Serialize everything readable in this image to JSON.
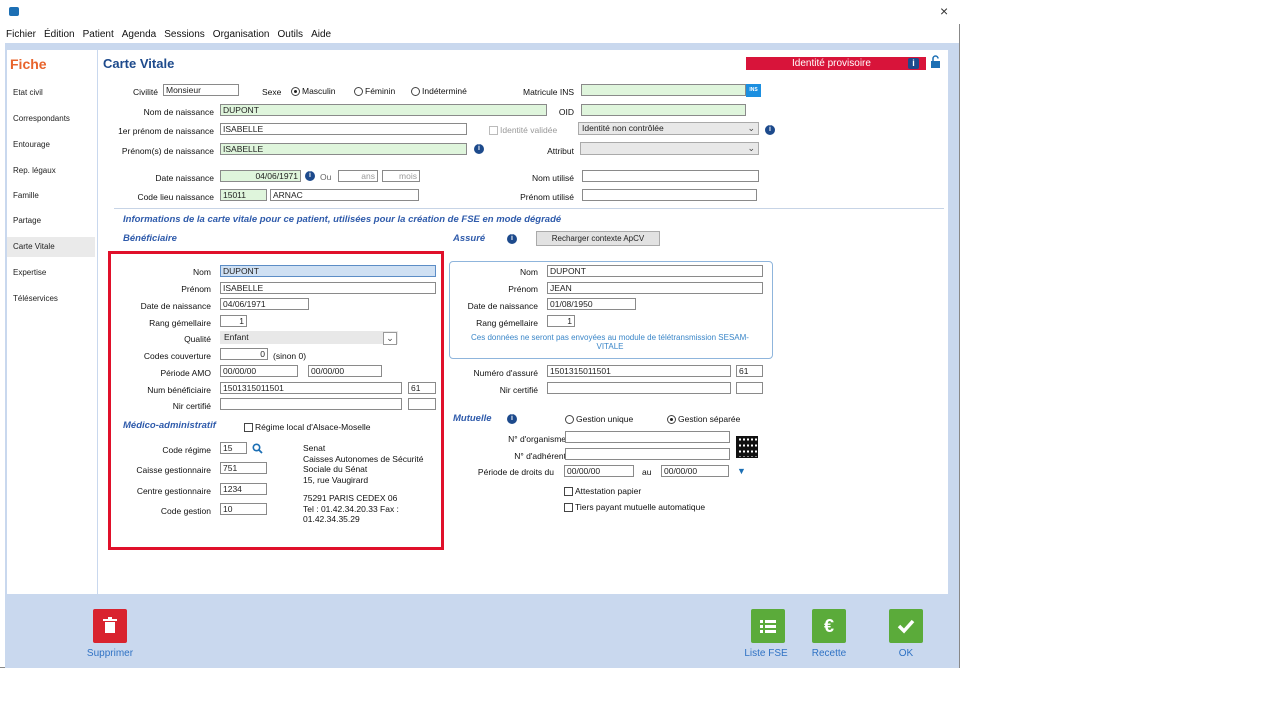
{
  "window": {
    "close": "×"
  },
  "menu": [
    "Fichier",
    "Édition",
    "Patient",
    "Agenda",
    "Sessions",
    "Organisation",
    "Outils",
    "Aide"
  ],
  "sidebar": {
    "title": "Fiche",
    "items": [
      "Etat civil",
      "Correspondants",
      "Entourage",
      "Rep. légaux",
      "Famille",
      "Partage",
      "Carte Vitale",
      "Expertise",
      "Téléservices"
    ],
    "active": "Carte Vitale"
  },
  "header": {
    "title": "Carte Vitale",
    "banner": "Identité provisoire",
    "banner_info": "i"
  },
  "identity": {
    "civilite_label": "Civilité",
    "civilite": "Monsieur",
    "sexe_label": "Sexe",
    "sexe_options": [
      "Masculin",
      "Féminin",
      "Indéterminé"
    ],
    "sexe_selected": "Masculin",
    "matricule_label": "Matricule INS",
    "matricule": "",
    "ins_badge": "INS",
    "nom_label": "Nom de naissance",
    "nom": "DUPONT",
    "oid_label": "OID",
    "oid": "",
    "prenom1_label": "1er prénom de naissance",
    "prenom1": "ISABELLE",
    "identite_validee_label": "Identité validée",
    "identite_status": "Identité non contrôlée",
    "prenoms_label": "Prénom(s) de naissance",
    "prenoms": "ISABELLE",
    "attribut_label": "Attribut",
    "attribut": "",
    "date_label": "Date naissance",
    "date": "04/06/1971",
    "ou_label": "Ou",
    "ans_placeholder": "ans",
    "mois_placeholder": "mois",
    "nom_utilise_label": "Nom utilisé",
    "nom_utilise": "",
    "code_lieu_label": "Code lieu naissance",
    "code_lieu": "15011",
    "lieu": "ARNAC",
    "prenom_utilise_label": "Prénom utilisé",
    "prenom_utilise": ""
  },
  "carte": {
    "info_text": "Informations de la carte vitale pour ce patient, utilisées pour la création de FSE en mode dégradé",
    "beneficiaire_title": "Bénéficiaire",
    "assure_title": "Assuré",
    "recharger_button": "Recharger contexte ApCV"
  },
  "beneficiaire": {
    "nom_label": "Nom",
    "nom": "DUPONT",
    "prenom_label": "Prénom",
    "prenom": "ISABELLE",
    "date_label": "Date de naissance",
    "date": "04/06/1971",
    "rang_label": "Rang gémellaire",
    "rang": "1",
    "qualite_label": "Qualité",
    "qualite": "Enfant",
    "codes_label": "Codes couverture",
    "codes": "0",
    "codes_hint": "(sinon 0)",
    "periode_label": "Période AMO",
    "periode_debut": "00/00/00",
    "periode_fin": "00/00/00",
    "num_label": "Num bénéficiaire",
    "num": "1501315011501",
    "num_cle": "61",
    "nir_label": "Nir certifié",
    "nir": "",
    "nir_cle": ""
  },
  "medico": {
    "title": "Médico-administratif",
    "regime_local_label": "Régime local d'Alsace-Moselle",
    "code_regime_label": "Code régime",
    "code_regime": "15",
    "caisse_label": "Caisse gestionnaire",
    "caisse": "751",
    "centre_label": "Centre gestionnaire",
    "centre": "1234",
    "code_gestion_label": "Code gestion",
    "code_gestion": "10",
    "address_lines": [
      "Senat",
      "Caisses Autonomes de Sécurité",
      "Sociale du Sénat",
      "15, rue Vaugirard",
      "",
      "75291 PARIS CEDEX 06",
      "Tel : 01.42.34.20.33 Fax :",
      "01.42.34.35.29"
    ]
  },
  "assure": {
    "nom_label": "Nom",
    "nom": "DUPONT",
    "prenom_label": "Prénom",
    "prenom": "JEAN",
    "date_label": "Date de naissance",
    "date": "01/08/1950",
    "rang_label": "Rang gémellaire",
    "rang": "1",
    "note": "Ces données ne seront pas envoyées au module de télétransmission SESAM-VITALE",
    "numero_label": "Numéro d'assuré",
    "numero": "1501315011501",
    "numero_cle": "61",
    "nir_label": "Nir certifié",
    "nir": "",
    "nir_cle": ""
  },
  "mutuelle": {
    "title": "Mutuelle",
    "gestion_options": [
      "Gestion unique",
      "Gestion séparée"
    ],
    "gestion_selected": "Gestion séparée",
    "organisme_label": "N° d'organisme",
    "organisme": "",
    "adherent_label": "N° d'adhérent",
    "adherent": "",
    "periode_label": "Période de droits du",
    "periode_debut": "00/00/00",
    "au_label": "au",
    "periode_fin": "00/00/00",
    "attestation_label": "Attestation papier",
    "tiers_label": "Tiers payant mutuelle automatique"
  },
  "footer": {
    "supprimer": "Supprimer",
    "liste_fse": "Liste FSE",
    "recette": "Recette",
    "ok": "OK",
    "colors": {
      "delete": "#d9232e",
      "green": "#5bab3a"
    }
  }
}
